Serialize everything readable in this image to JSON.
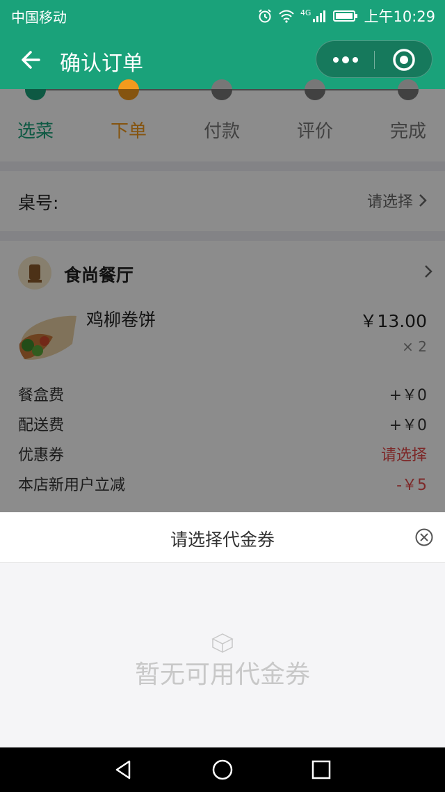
{
  "status_bar": {
    "carrier": "中国移动",
    "network": "4G",
    "time": "上午10:29"
  },
  "nav": {
    "title": "确认订单"
  },
  "steps": [
    {
      "label": "选菜",
      "color": "#1aa27a"
    },
    {
      "label": "下单",
      "color": "#f39a1d"
    },
    {
      "label": "付款",
      "color": "#777777"
    },
    {
      "label": "评价",
      "color": "#777777"
    },
    {
      "label": "完成",
      "color": "#777777"
    }
  ],
  "table": {
    "label": "桌号:",
    "value": "请选择"
  },
  "shop": {
    "name": "食尚餐厅"
  },
  "order_item": {
    "name": "鸡柳卷饼",
    "price": "￥13.00",
    "quantity": "× 2"
  },
  "fees": [
    {
      "label": "餐盒费",
      "value": "+￥0"
    },
    {
      "label": "配送费",
      "value": "+￥0"
    },
    {
      "label": "优惠券",
      "value": "请选择"
    },
    {
      "label": "本店新用户立减",
      "value": "-￥5"
    }
  ],
  "voucher_sheet": {
    "title": "请选择代金券",
    "empty_text": "暂无可用代金券"
  },
  "colors": {
    "brand_green": "#1aa27a",
    "accent_orange": "#f39a1d",
    "alert_red": "#e34b4b"
  }
}
